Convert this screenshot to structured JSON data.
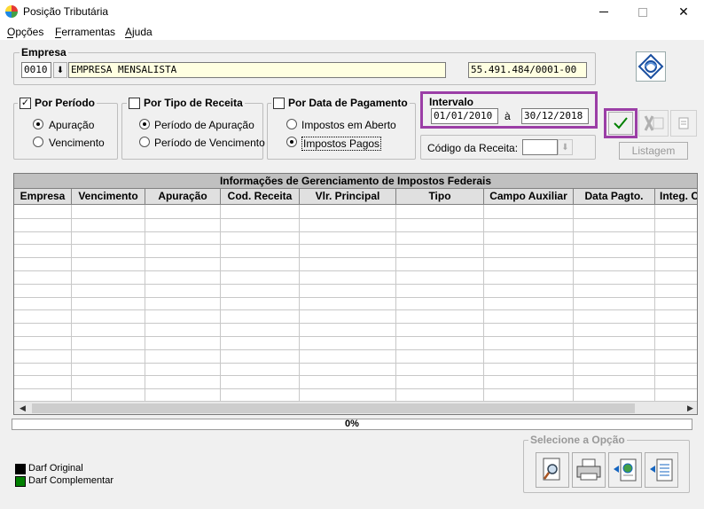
{
  "window": {
    "title": "Posição Tributária"
  },
  "menu": {
    "opcoes": "Opções",
    "ferramentas": "Ferramentas",
    "ajuda": "Ajuda"
  },
  "empresa": {
    "label": "Empresa",
    "code": "0010",
    "name": "EMPRESA MENSALISTA",
    "cnpj": "55.491.484/0001-00"
  },
  "por_periodo": {
    "label": "Por Período",
    "checked": true,
    "options": [
      "Apuração",
      "Vencimento"
    ],
    "selected": 0
  },
  "por_tipo_receita": {
    "label": "Por Tipo de Receita",
    "checked": false,
    "options": [
      "Período de Apuração",
      "Período de Vencimento"
    ],
    "selected": 0
  },
  "por_data_pagamento": {
    "label": "Por Data de Pagamento",
    "checked": false,
    "options": [
      "Impostos em Aberto",
      "Impostos Pagos"
    ],
    "selected": 1
  },
  "intervalo": {
    "label": "Intervalo",
    "from": "01/01/2010",
    "sep": "à",
    "to": "30/12/2018"
  },
  "codigo_receita": {
    "label": "Código da Receita:",
    "value": ""
  },
  "listagem": {
    "label": "Listagem"
  },
  "grid": {
    "title": "Informações de Gerenciamento de Impostos Federais",
    "columns": [
      "Empresa",
      "Vencimento",
      "Apuração",
      "Cod. Receita",
      "Vlr. Principal",
      "Tipo",
      "Campo Auxiliar",
      "Data Pagto.",
      "Integ. C"
    ]
  },
  "progress": {
    "text": "0%",
    "value": 0
  },
  "legend": [
    {
      "label": "Darf Original",
      "color": "#000000"
    },
    {
      "label": "Darf Complementar",
      "color": "#008000"
    }
  ],
  "options_panel": {
    "label": "Selecione a Opção"
  },
  "colors": {
    "highlight": "#9b3ea6",
    "confirm": "#008000"
  }
}
